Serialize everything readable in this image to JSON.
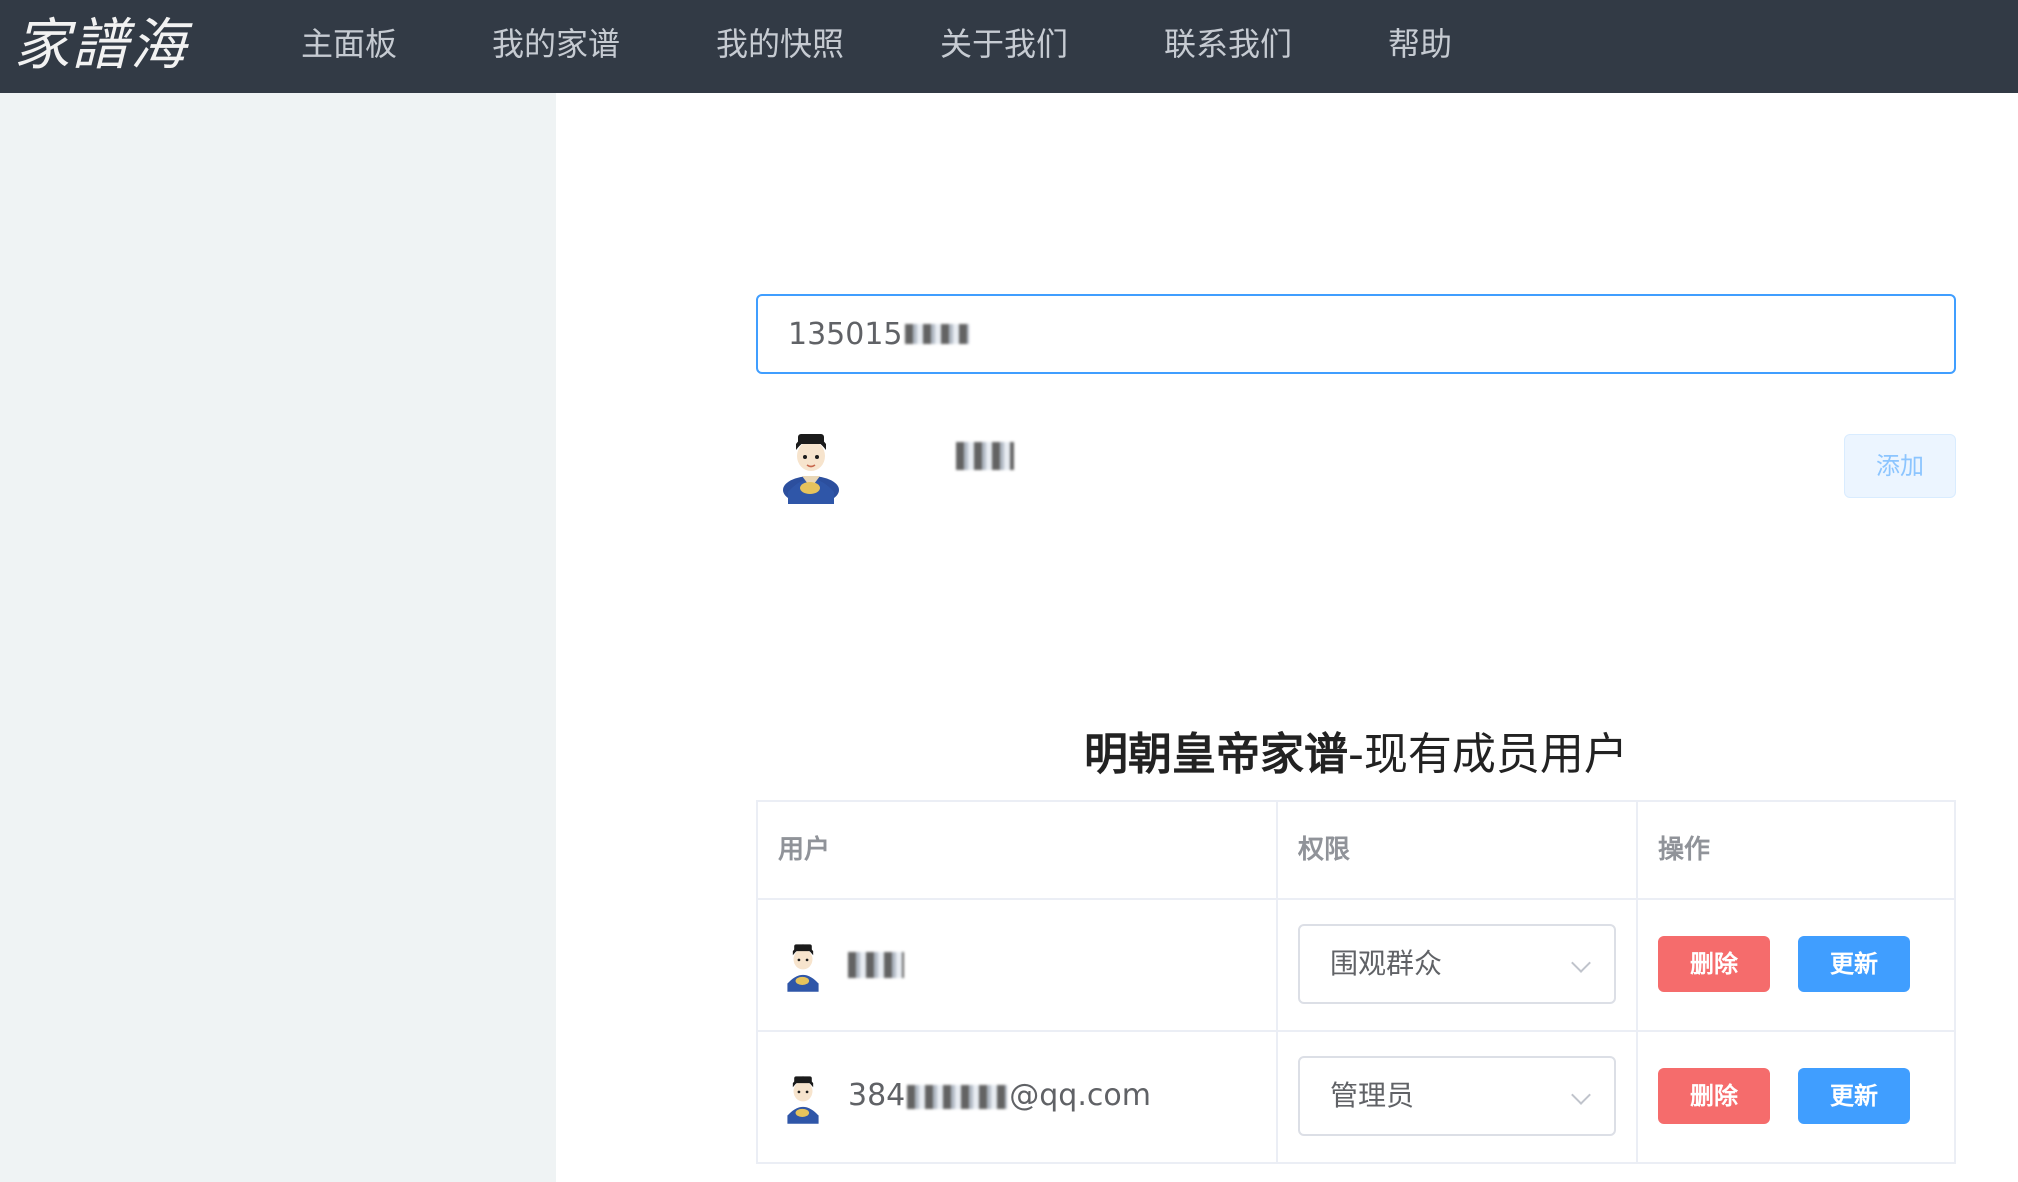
{
  "brand": {
    "logo_text": "家譜海"
  },
  "nav": {
    "items": [
      {
        "label": "主面板"
      },
      {
        "label": "我的家谱"
      },
      {
        "label": "我的快照"
      },
      {
        "label": "关于我们"
      },
      {
        "label": "联系我们"
      },
      {
        "label": "帮助"
      }
    ]
  },
  "search": {
    "value_visible": "135015"
  },
  "result": {
    "add_label": "添加"
  },
  "section": {
    "title_bold": "明朝皇帝家谱",
    "title_rest": "-现有成员用户"
  },
  "table": {
    "headers": {
      "user": "用户",
      "permission": "权限",
      "actions": "操作"
    },
    "rows": [
      {
        "user_visible": "",
        "permission": "围观群众",
        "delete_label": "删除",
        "update_label": "更新"
      },
      {
        "user_prefix": "384",
        "user_suffix": "@qq.com",
        "permission": "管理员",
        "delete_label": "删除",
        "update_label": "更新"
      }
    ]
  },
  "colors": {
    "nav_bg": "#323a45",
    "primary": "#409eff",
    "danger": "#f56c6c",
    "sidebar_bg": "#eff3f4"
  }
}
